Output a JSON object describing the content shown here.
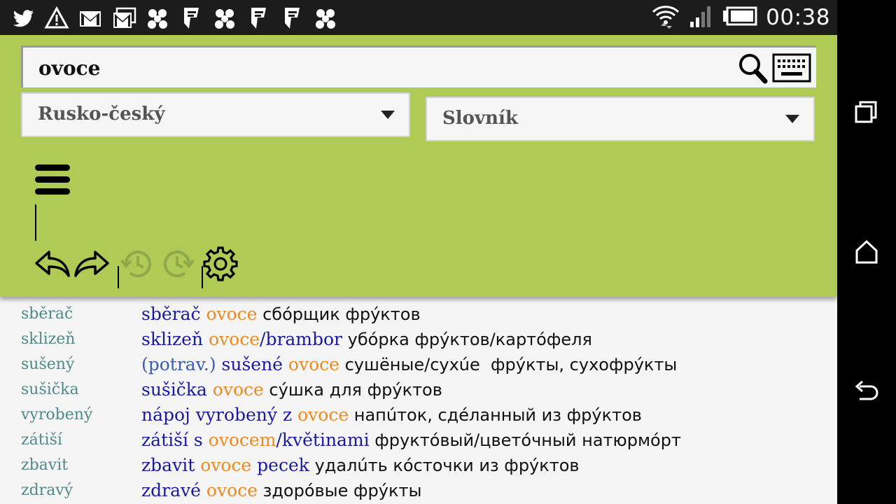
{
  "status_bar": {
    "time": "00:38",
    "icons": [
      "twitter-icon",
      "alert-icon",
      "gmail-icon",
      "mail-stack-icon",
      "app-icon",
      "foursquare-icon",
      "app-icon",
      "foursquare-icon",
      "foursquare-icon",
      "app-icon"
    ]
  },
  "search": {
    "value": "ovoce",
    "placeholder": ""
  },
  "dictionary_select": {
    "selected": "Rusko-český"
  },
  "mode_select": {
    "selected": "Slovník"
  },
  "results": [
    {
      "headword": "sběrač",
      "parts": [
        {
          "t": "cz",
          "v": "sběrač "
        },
        {
          "t": "kw",
          "v": "ovoce"
        },
        {
          "t": "ru",
          "v": " сбóрщик фрýктов"
        }
      ]
    },
    {
      "headword": "sklizeň",
      "parts": [
        {
          "t": "cz",
          "v": "sklizeň "
        },
        {
          "t": "kw",
          "v": "ovoce"
        },
        {
          "t": "cz",
          "v": "/brambor"
        },
        {
          "t": "ru",
          "v": " убóрка фрýктов/картóфеля"
        }
      ]
    },
    {
      "headword": "sušený",
      "parts": [
        {
          "t": "lb",
          "v": "(potrav.) "
        },
        {
          "t": "cz",
          "v": "sušené "
        },
        {
          "t": "kw",
          "v": "ovoce"
        },
        {
          "t": "ru",
          "v": " сушёные/сухúе  фрýкты, сухофрýкты"
        }
      ]
    },
    {
      "headword": "sušička",
      "parts": [
        {
          "t": "cz",
          "v": "sušička "
        },
        {
          "t": "kw",
          "v": "ovoce"
        },
        {
          "t": "ru",
          "v": " сýшка для фрýктов"
        }
      ]
    },
    {
      "headword": "vyrobený",
      "parts": [
        {
          "t": "cz",
          "v": "nápoj vyrobený z "
        },
        {
          "t": "kw",
          "v": "ovoce"
        },
        {
          "t": "ru",
          "v": " напúток, сдéланный из фрýктов"
        }
      ]
    },
    {
      "headword": "zátiší",
      "parts": [
        {
          "t": "cz",
          "v": "zátiší s "
        },
        {
          "t": "kw",
          "v": "ovocem"
        },
        {
          "t": "cz",
          "v": "/květinami"
        },
        {
          "t": "ru",
          "v": " фруктóвый/цветóчный натюрмóрт"
        }
      ]
    },
    {
      "headword": "zbavit",
      "parts": [
        {
          "t": "cz",
          "v": "zbavit "
        },
        {
          "t": "kw",
          "v": "ovoce"
        },
        {
          "t": "cz",
          "v": " pecek"
        },
        {
          "t": "ru",
          "v": " удалúть кóсточки из фрýктов"
        }
      ]
    },
    {
      "headword": "zdravý",
      "parts": [
        {
          "t": "cz",
          "v": "zdravé "
        },
        {
          "t": "kw",
          "v": "ovoce"
        },
        {
          "t": "ru",
          "v": " здорóвые фрýкты"
        }
      ]
    }
  ],
  "colors": {
    "panel_bg": "#b0cb55",
    "headword": "#4e8a88",
    "czech": "#1a1aa0",
    "keyword": "#f08a20",
    "russian": "#111111"
  }
}
